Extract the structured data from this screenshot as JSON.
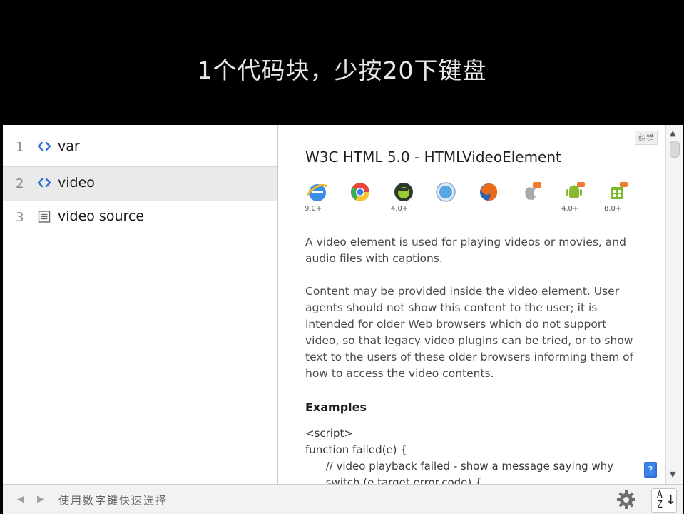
{
  "slide": {
    "title": "1个代码块，少按20下键盘"
  },
  "list": {
    "items": [
      {
        "num": "1",
        "label": "var",
        "icon": "code-brackets-icon"
      },
      {
        "num": "2",
        "label": "video",
        "icon": "code-brackets-icon",
        "selected": true
      },
      {
        "num": "3",
        "label": "video source",
        "icon": "document-list-icon"
      }
    ]
  },
  "doc": {
    "report_label": "纠错",
    "title": "W3C HTML 5.0 - HTMLVideoElement",
    "browsers": [
      {
        "name": "ie-icon",
        "version": "9.0+"
      },
      {
        "name": "chrome-icon",
        "version": ""
      },
      {
        "name": "android-browser-icon",
        "version": "4.0+"
      },
      {
        "name": "safari-icon",
        "version": ""
      },
      {
        "name": "firefox-icon",
        "version": ""
      },
      {
        "name": "ios-safari-icon",
        "version": ""
      },
      {
        "name": "android-icon",
        "version": "4.0+"
      },
      {
        "name": "windows-phone-icon",
        "version": "8.0+"
      }
    ],
    "paragraph1": "A video element is used for playing videos or movies, and audio files with captions.",
    "paragraph2": "Content may be provided inside the video element. User agents should not show this content to the user; it is intended for older Web browsers which do not support video, so that legacy video plugins can be tried, or to show text to the users of these older browsers informing them of how to access the video contents.",
    "examples_heading": "Examples",
    "code_lines": [
      "<script>",
      "function failed(e) {",
      "      // video playback failed - show a message saying why",
      "      switch (e.target.error.code) {"
    ]
  },
  "bottom": {
    "hint": "使用数字键快速选择",
    "sort_label_top": "A",
    "sort_label_bottom": "Z"
  },
  "colors": {
    "icon_blue": "#2f6fd6",
    "selected_bg": "#eaeaea",
    "text_gray": "#4a4a4a"
  }
}
